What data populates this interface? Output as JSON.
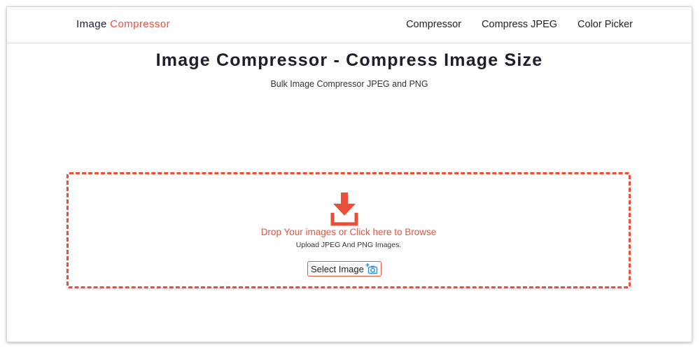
{
  "brand": {
    "part1": "Image",
    "part2": "Compressor"
  },
  "nav": {
    "items": [
      "Compressor",
      "Compress JPEG",
      "Color Picker"
    ]
  },
  "hero": {
    "title": "Image Compressor - Compress Image Size",
    "subtitle": "Bulk Image Compressor JPEG and PNG"
  },
  "upload": {
    "drop_text": "Drop Your images or Click here to Browse",
    "hint": "Upload JPEG And PNG Images.",
    "button_label": "Select Image"
  },
  "icons": {
    "download": "download-arrow-icon",
    "camera": "add-photo-camera-icon"
  },
  "colors": {
    "accent": "#e8523b",
    "dark_text": "#1b1b3a",
    "dropzone_border": "#ea4f37"
  }
}
